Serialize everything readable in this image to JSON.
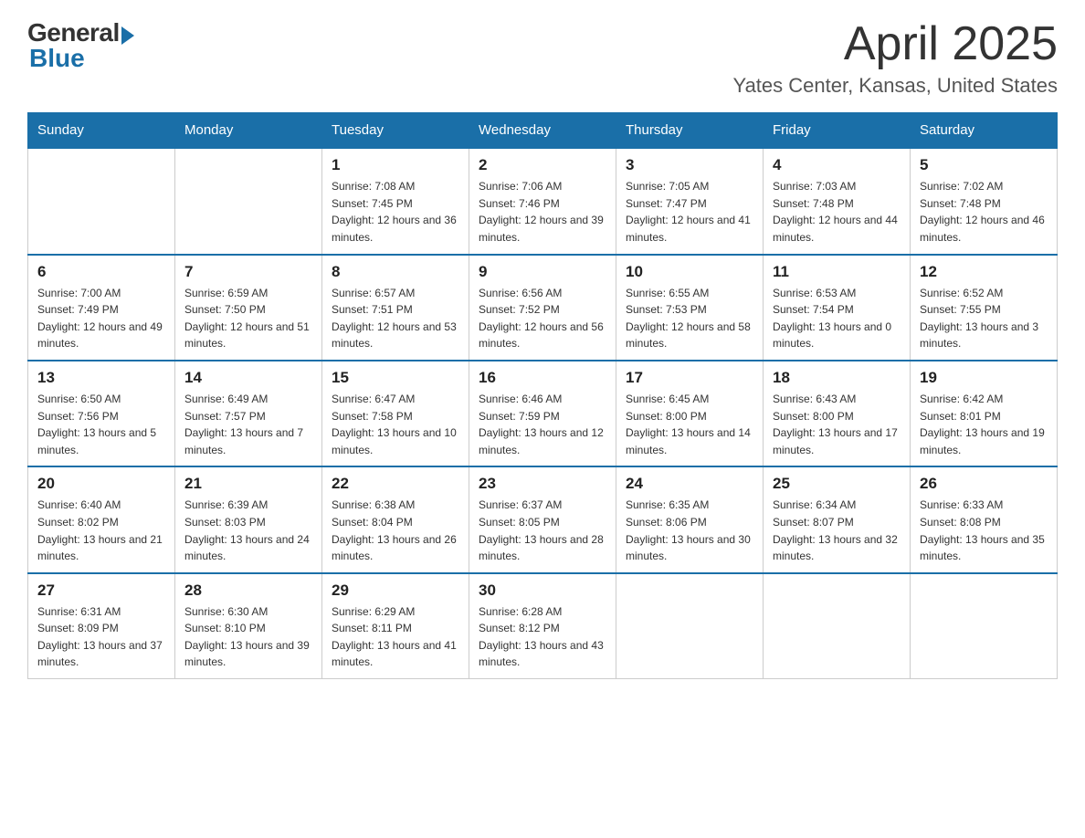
{
  "header": {
    "logo_general": "General",
    "logo_blue": "Blue",
    "month_title": "April 2025",
    "location": "Yates Center, Kansas, United States"
  },
  "weekdays": [
    "Sunday",
    "Monday",
    "Tuesday",
    "Wednesday",
    "Thursday",
    "Friday",
    "Saturday"
  ],
  "weeks": [
    [
      {
        "day": "",
        "sunrise": "",
        "sunset": "",
        "daylight": ""
      },
      {
        "day": "",
        "sunrise": "",
        "sunset": "",
        "daylight": ""
      },
      {
        "day": "1",
        "sunrise": "Sunrise: 7:08 AM",
        "sunset": "Sunset: 7:45 PM",
        "daylight": "Daylight: 12 hours and 36 minutes."
      },
      {
        "day": "2",
        "sunrise": "Sunrise: 7:06 AM",
        "sunset": "Sunset: 7:46 PM",
        "daylight": "Daylight: 12 hours and 39 minutes."
      },
      {
        "day": "3",
        "sunrise": "Sunrise: 7:05 AM",
        "sunset": "Sunset: 7:47 PM",
        "daylight": "Daylight: 12 hours and 41 minutes."
      },
      {
        "day": "4",
        "sunrise": "Sunrise: 7:03 AM",
        "sunset": "Sunset: 7:48 PM",
        "daylight": "Daylight: 12 hours and 44 minutes."
      },
      {
        "day": "5",
        "sunrise": "Sunrise: 7:02 AM",
        "sunset": "Sunset: 7:48 PM",
        "daylight": "Daylight: 12 hours and 46 minutes."
      }
    ],
    [
      {
        "day": "6",
        "sunrise": "Sunrise: 7:00 AM",
        "sunset": "Sunset: 7:49 PM",
        "daylight": "Daylight: 12 hours and 49 minutes."
      },
      {
        "day": "7",
        "sunrise": "Sunrise: 6:59 AM",
        "sunset": "Sunset: 7:50 PM",
        "daylight": "Daylight: 12 hours and 51 minutes."
      },
      {
        "day": "8",
        "sunrise": "Sunrise: 6:57 AM",
        "sunset": "Sunset: 7:51 PM",
        "daylight": "Daylight: 12 hours and 53 minutes."
      },
      {
        "day": "9",
        "sunrise": "Sunrise: 6:56 AM",
        "sunset": "Sunset: 7:52 PM",
        "daylight": "Daylight: 12 hours and 56 minutes."
      },
      {
        "day": "10",
        "sunrise": "Sunrise: 6:55 AM",
        "sunset": "Sunset: 7:53 PM",
        "daylight": "Daylight: 12 hours and 58 minutes."
      },
      {
        "day": "11",
        "sunrise": "Sunrise: 6:53 AM",
        "sunset": "Sunset: 7:54 PM",
        "daylight": "Daylight: 13 hours and 0 minutes."
      },
      {
        "day": "12",
        "sunrise": "Sunrise: 6:52 AM",
        "sunset": "Sunset: 7:55 PM",
        "daylight": "Daylight: 13 hours and 3 minutes."
      }
    ],
    [
      {
        "day": "13",
        "sunrise": "Sunrise: 6:50 AM",
        "sunset": "Sunset: 7:56 PM",
        "daylight": "Daylight: 13 hours and 5 minutes."
      },
      {
        "day": "14",
        "sunrise": "Sunrise: 6:49 AM",
        "sunset": "Sunset: 7:57 PM",
        "daylight": "Daylight: 13 hours and 7 minutes."
      },
      {
        "day": "15",
        "sunrise": "Sunrise: 6:47 AM",
        "sunset": "Sunset: 7:58 PM",
        "daylight": "Daylight: 13 hours and 10 minutes."
      },
      {
        "day": "16",
        "sunrise": "Sunrise: 6:46 AM",
        "sunset": "Sunset: 7:59 PM",
        "daylight": "Daylight: 13 hours and 12 minutes."
      },
      {
        "day": "17",
        "sunrise": "Sunrise: 6:45 AM",
        "sunset": "Sunset: 8:00 PM",
        "daylight": "Daylight: 13 hours and 14 minutes."
      },
      {
        "day": "18",
        "sunrise": "Sunrise: 6:43 AM",
        "sunset": "Sunset: 8:00 PM",
        "daylight": "Daylight: 13 hours and 17 minutes."
      },
      {
        "day": "19",
        "sunrise": "Sunrise: 6:42 AM",
        "sunset": "Sunset: 8:01 PM",
        "daylight": "Daylight: 13 hours and 19 minutes."
      }
    ],
    [
      {
        "day": "20",
        "sunrise": "Sunrise: 6:40 AM",
        "sunset": "Sunset: 8:02 PM",
        "daylight": "Daylight: 13 hours and 21 minutes."
      },
      {
        "day": "21",
        "sunrise": "Sunrise: 6:39 AM",
        "sunset": "Sunset: 8:03 PM",
        "daylight": "Daylight: 13 hours and 24 minutes."
      },
      {
        "day": "22",
        "sunrise": "Sunrise: 6:38 AM",
        "sunset": "Sunset: 8:04 PM",
        "daylight": "Daylight: 13 hours and 26 minutes."
      },
      {
        "day": "23",
        "sunrise": "Sunrise: 6:37 AM",
        "sunset": "Sunset: 8:05 PM",
        "daylight": "Daylight: 13 hours and 28 minutes."
      },
      {
        "day": "24",
        "sunrise": "Sunrise: 6:35 AM",
        "sunset": "Sunset: 8:06 PM",
        "daylight": "Daylight: 13 hours and 30 minutes."
      },
      {
        "day": "25",
        "sunrise": "Sunrise: 6:34 AM",
        "sunset": "Sunset: 8:07 PM",
        "daylight": "Daylight: 13 hours and 32 minutes."
      },
      {
        "day": "26",
        "sunrise": "Sunrise: 6:33 AM",
        "sunset": "Sunset: 8:08 PM",
        "daylight": "Daylight: 13 hours and 35 minutes."
      }
    ],
    [
      {
        "day": "27",
        "sunrise": "Sunrise: 6:31 AM",
        "sunset": "Sunset: 8:09 PM",
        "daylight": "Daylight: 13 hours and 37 minutes."
      },
      {
        "day": "28",
        "sunrise": "Sunrise: 6:30 AM",
        "sunset": "Sunset: 8:10 PM",
        "daylight": "Daylight: 13 hours and 39 minutes."
      },
      {
        "day": "29",
        "sunrise": "Sunrise: 6:29 AM",
        "sunset": "Sunset: 8:11 PM",
        "daylight": "Daylight: 13 hours and 41 minutes."
      },
      {
        "day": "30",
        "sunrise": "Sunrise: 6:28 AM",
        "sunset": "Sunset: 8:12 PM",
        "daylight": "Daylight: 13 hours and 43 minutes."
      },
      {
        "day": "",
        "sunrise": "",
        "sunset": "",
        "daylight": ""
      },
      {
        "day": "",
        "sunrise": "",
        "sunset": "",
        "daylight": ""
      },
      {
        "day": "",
        "sunrise": "",
        "sunset": "",
        "daylight": ""
      }
    ]
  ]
}
